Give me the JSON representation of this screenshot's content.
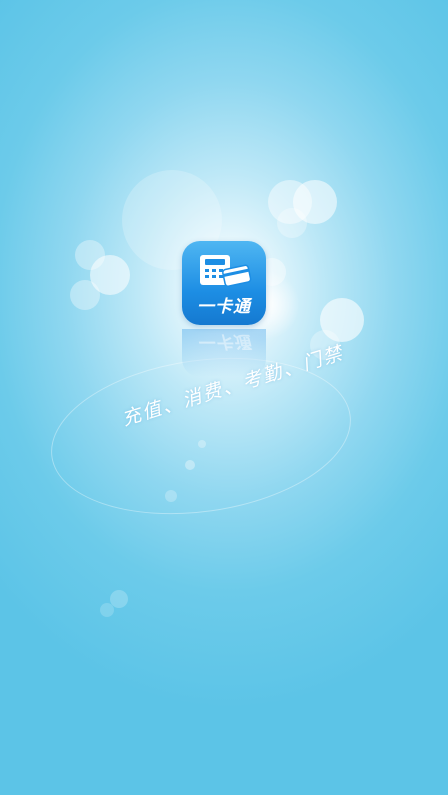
{
  "splash": {
    "app_name": "一卡通",
    "tagline": "充值、消费、考勤、门禁"
  },
  "icons": {
    "app_icon": "card-register-icon"
  },
  "colors": {
    "background": "#5cc4e7",
    "icon_top": "#4fb6f2",
    "icon_bottom": "#1579d0"
  }
}
